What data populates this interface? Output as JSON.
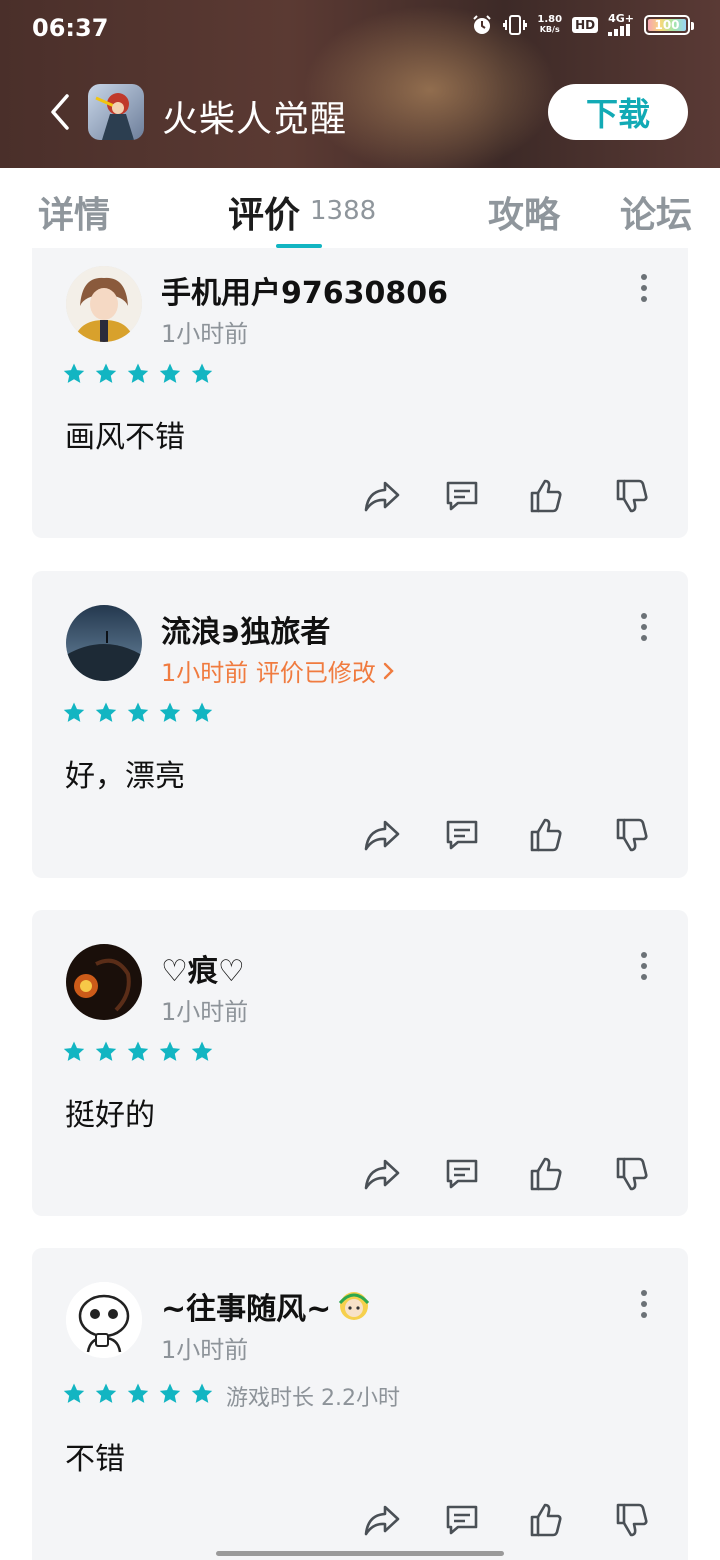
{
  "status_bar": {
    "time": "06:37",
    "net_speed_value": "1.80",
    "net_speed_unit": "KB/s",
    "hd": "HD",
    "network": "4G+",
    "battery": "100"
  },
  "header": {
    "app_name": "火柴人觉醒",
    "download_label": "下载"
  },
  "tabs": {
    "details": "详情",
    "reviews": "评价",
    "reviews_count": "1388",
    "guides": "攻略",
    "forum": "论坛",
    "active": "reviews"
  },
  "colors": {
    "accent": "#12b5c2",
    "edited": "#f07b3f"
  },
  "reviews": [
    {
      "username": "手机用户97630806",
      "time": "1小时前",
      "rating": 5,
      "text": "画风不错"
    },
    {
      "username": "流浪϶独旅者",
      "time": "1小时前 评价已修改",
      "edited": true,
      "rating": 5,
      "text": "好，漂亮"
    },
    {
      "username": "♡痕♡",
      "time": "1小时前",
      "rating": 5,
      "text": "挺好的"
    },
    {
      "username": "~往事随风~",
      "time": "1小时前",
      "rating": 5,
      "playtime": "游戏时长 2.2小时",
      "text": "不错"
    }
  ],
  "icons": {
    "back": "chevron-left-icon",
    "share": "share-icon",
    "comment": "comment-icon",
    "like": "thumbs-up-icon",
    "dislike": "thumbs-down-icon",
    "more": "more-vertical-icon"
  }
}
